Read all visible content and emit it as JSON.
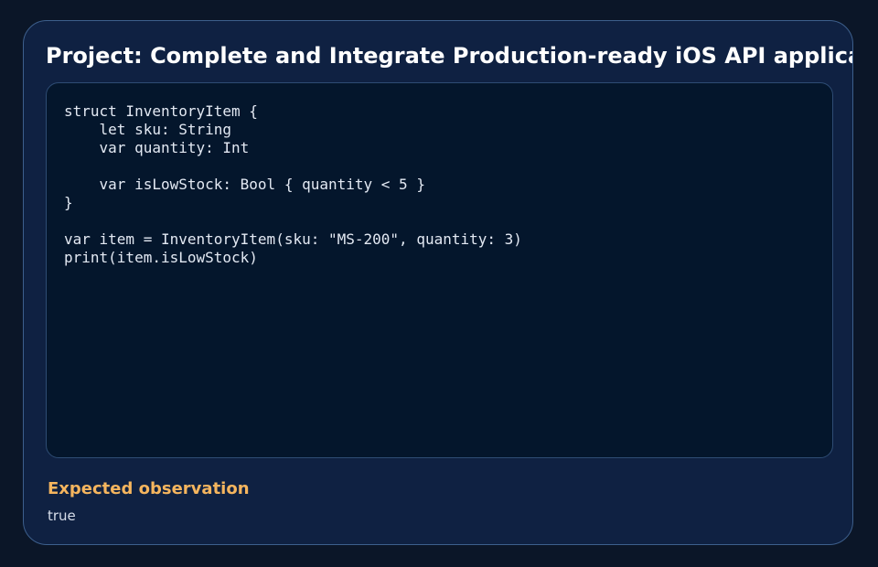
{
  "card": {
    "title": "Project: Complete and Integrate Production-ready iOS API application"
  },
  "code_block": {
    "language": "swift",
    "code": "struct InventoryItem {\n    let sku: String\n    var quantity: Int\n\n    var isLowStock: Bool { quantity < 5 }\n}\n\nvar item = InventoryItem(sku: \"MS-200\", quantity: 3)\nprint(item.isLowStock)"
  },
  "observation": {
    "heading": "Expected observation",
    "value": "true"
  },
  "colors": {
    "page_background": "#0b1628",
    "card_background": "#0f2142",
    "card_border": "#3d5f8c",
    "code_background": "#04162c",
    "heading_accent": "#f5b55e",
    "title_text": "#ffffff"
  }
}
